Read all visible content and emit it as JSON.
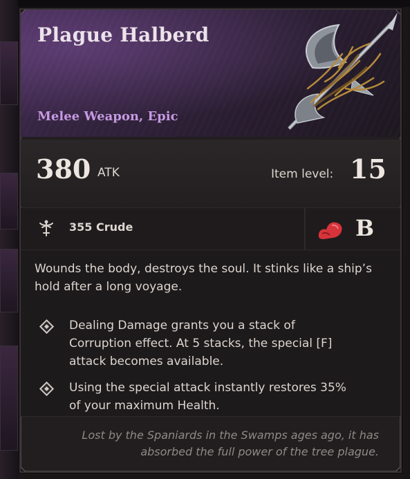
{
  "item": {
    "name": "Plague Halberd",
    "category": "Melee Weapon, Epic",
    "rarity_color": "#c69ae2"
  },
  "stats": {
    "atk_value": "380",
    "atk_unit": "ATK",
    "item_level_label": "Item level:",
    "item_level_value": "15"
  },
  "requirement": {
    "icon": "crude-emblem-icon",
    "text": "355 Crude",
    "scaling_icon": "strength-arm-icon",
    "scaling_grade": "B"
  },
  "description": "Wounds the body, destroys the soul. It stinks like a ship’s hold after a long voyage.",
  "effects": [
    "Dealing Damage grants you a stack of Corruption effect. At 5 stacks, the special [F] attack becomes available.",
    "Using the special attack instantly restores 35% of your maximum Health."
  ],
  "flavor": "Lost by the Spaniards in the Swamps ages ago, it has absorbed the full power of the tree plague.",
  "colors": {
    "accent_purple": "#c69ae2",
    "text_main": "#ddd6d0",
    "flavor_text": "#8f8a86",
    "strength_red": "#d6343a"
  }
}
